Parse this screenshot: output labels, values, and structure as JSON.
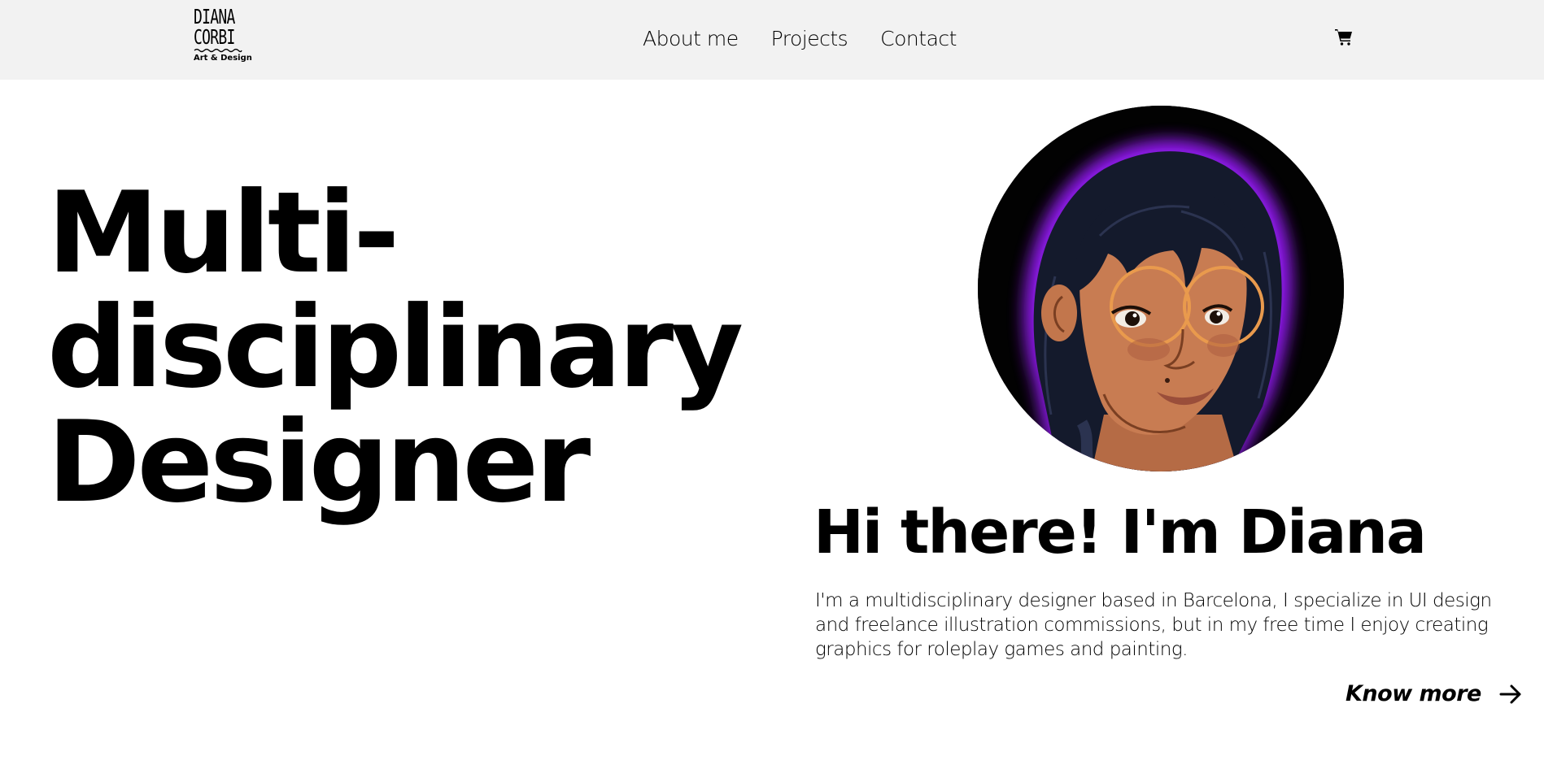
{
  "brand": {
    "logo_line1": "DIANA",
    "logo_line2": "CORBI",
    "logo_sub": "Art & Design"
  },
  "nav": {
    "items": [
      {
        "label": "About me"
      },
      {
        "label": "Projects"
      },
      {
        "label": "Contact"
      }
    ],
    "cart_icon": "shopping-cart-icon"
  },
  "hero": {
    "title_lines": [
      "Multi-",
      "disciplinary",
      "Designer"
    ]
  },
  "intro": {
    "greeting": "Hi there! I'm Diana",
    "bio": "I'm a multidisciplinary designer based in Barcelona, I specialize in UI design and freelance illustration commissions, but in my free time I enjoy creating graphics for roleplay games and painting.",
    "cta_label": "Know more",
    "cta_icon": "arrow-right-icon"
  },
  "colors": {
    "header_bg": "#f2f2f2",
    "avatar_glow": "#9b1dff",
    "text": "#000000"
  }
}
